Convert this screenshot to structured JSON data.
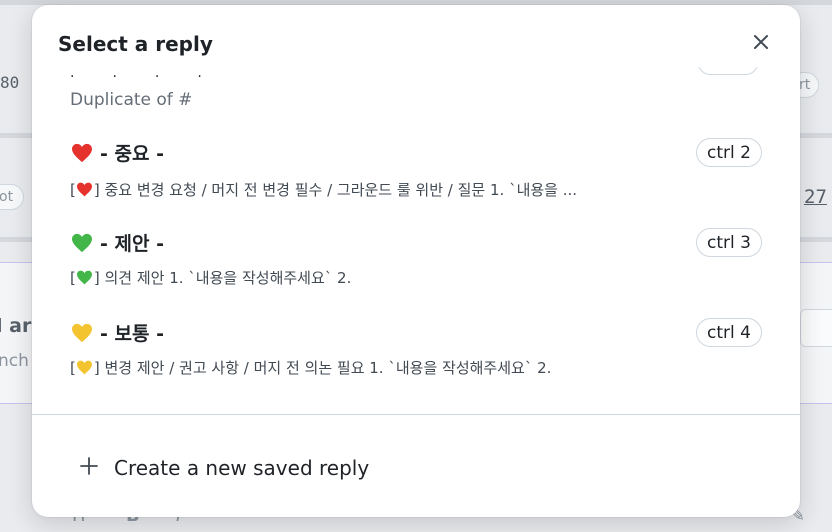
{
  "background": {
    "left_number": "80",
    "left_pill": "ot",
    "right_pill": "rt",
    "right_number": "27",
    "bold_fragment": "l ar",
    "soft_fragment": "nch"
  },
  "modal": {
    "title": "Select a reply",
    "close_icon": "close-icon",
    "duplicate_text": "Duplicate of #",
    "replies": [
      {
        "emoji": "red-heart",
        "color": "#e5322d",
        "title": "- 중요 -",
        "shortcut": "ctrl 2",
        "body_prefix": "[",
        "body_suffix": "] 중요 변경 요청 / 머지 전 변경 필수 / 그라운드 룰 위반 / 질문 1. `내용을 ..."
      },
      {
        "emoji": "green-heart",
        "color": "#43b649",
        "title": "- 제안 -",
        "shortcut": "ctrl 3",
        "body_prefix": "[",
        "body_suffix": "] 의견 제안 1. `내용을 작성해주세요` 2."
      },
      {
        "emoji": "yellow-heart",
        "color": "#f4c430",
        "title": "- 보통 -",
        "shortcut": "ctrl 4",
        "body_prefix": "[",
        "body_suffix": "] 변경 제안 / 권고 사항 / 머지 전 의논 필요 1. `내용을 작성해주세요` 2."
      }
    ],
    "create_label": "Create a new saved reply",
    "create_icon": "plus-icon"
  }
}
